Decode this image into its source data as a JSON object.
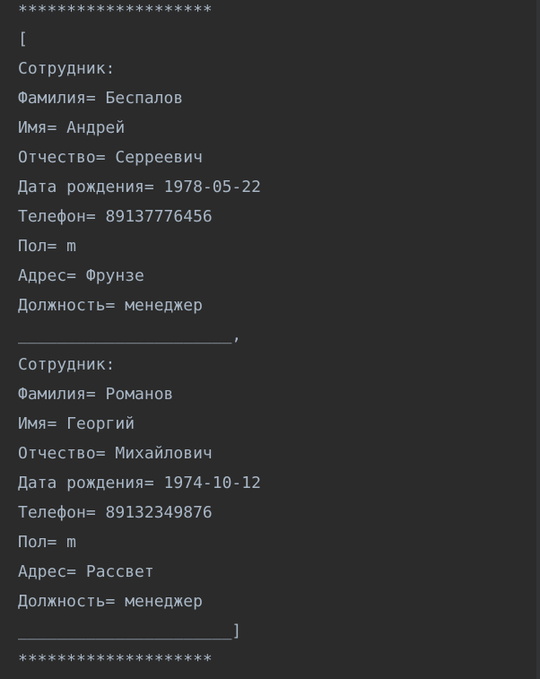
{
  "console": {
    "lines": [
      "********************",
      "[",
      "Сотрудник:",
      "Фамилия= Беспалов",
      "Имя= Андрей",
      "Отчество= Серреевич",
      "Дата рождения= 1978-05-22",
      "Телефон= 89137776456",
      "Пол= m",
      "Адрес= Фрунзе",
      "Должность= менеджер",
      "______________________,",
      "Сотрудник:",
      "Фамилия= Романов",
      "Имя= Георгий",
      "Отчество= Михайлович",
      "Дата рождения= 1974-10-12",
      "Телефон= 89132349876",
      "Пол= m",
      "Адрес= Рассвет",
      "Должность= менеджер",
      "______________________]",
      "********************"
    ]
  }
}
